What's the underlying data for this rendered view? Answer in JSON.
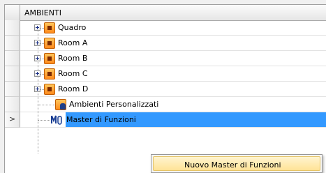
{
  "tree": {
    "header": "AMBIENTI",
    "items": [
      {
        "label": "Quadro",
        "icon": "room-icon",
        "expandable": true
      },
      {
        "label": "Room A",
        "icon": "room-icon",
        "expandable": true
      },
      {
        "label": "Room B",
        "icon": "room-icon",
        "expandable": true
      },
      {
        "label": "Room C",
        "icon": "room-icon",
        "expandable": true
      },
      {
        "label": "Room D",
        "icon": "room-icon",
        "expandable": true
      },
      {
        "label": "Ambienti Personalizzati",
        "icon": "custom-environments-icon",
        "expandable": false
      },
      {
        "label": "Master di Funzioni",
        "icon": "function-master-icon",
        "expandable": false,
        "selected": true
      }
    ],
    "current_row_marker": ">"
  },
  "context_menu": {
    "items": [
      {
        "label": "Nuovo Master di Funzioni"
      }
    ]
  },
  "colors": {
    "selection": "#3399ff",
    "room_icon": "#ff8a1c",
    "menu_highlight": "#ffe396"
  }
}
